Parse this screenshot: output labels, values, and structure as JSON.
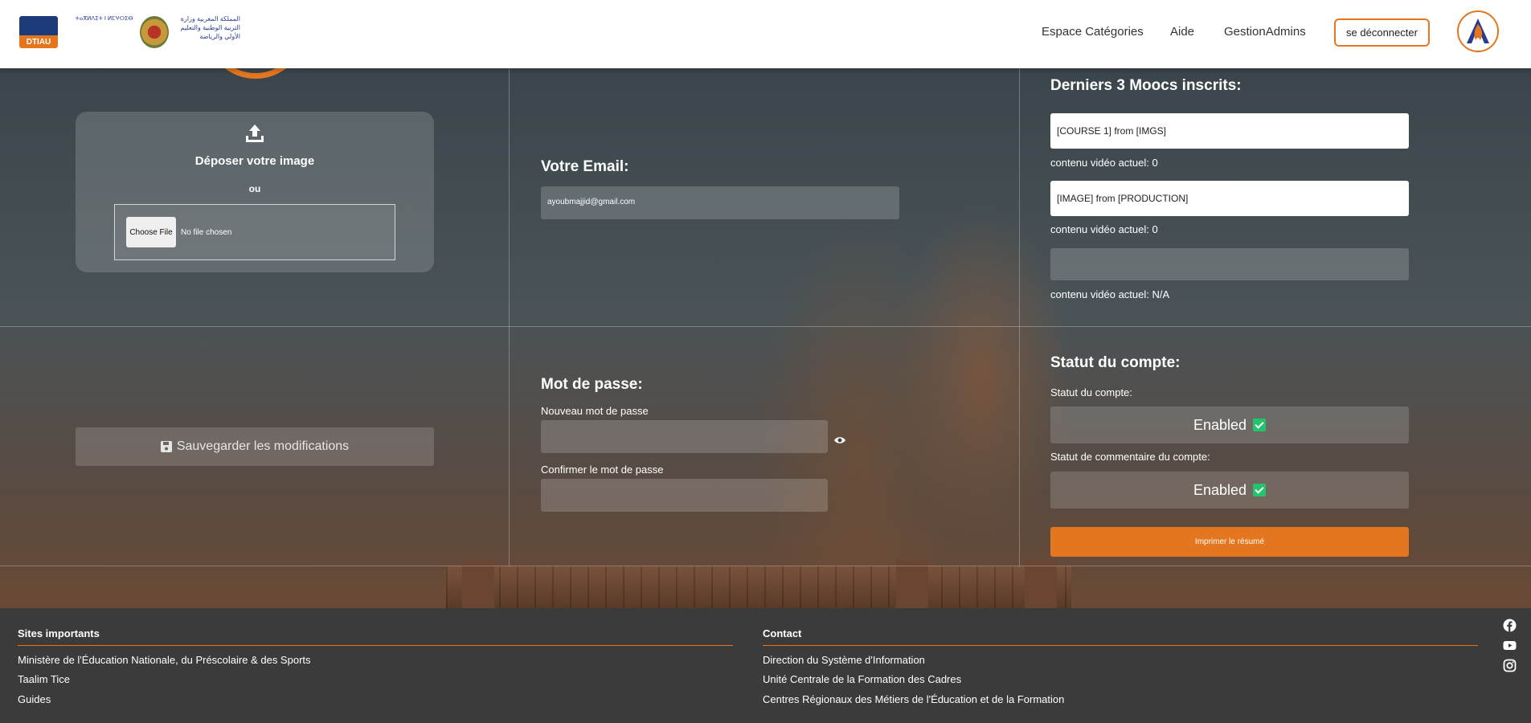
{
  "header": {
    "logo_text": "DTIAU",
    "ministry_latin": "ⵜⴰⴳⵍⴷⵉⵜ ⵏ ⵍⵎⵖⵔⵉⴱ",
    "ministry_arabic": "المملكة المغربية وزارة التربية الوطنية والتعليم الأولي والرياضة",
    "nav": [
      "Espace Catégories",
      "Aide",
      "GestionAdmins"
    ],
    "logout_label": "se déconnecter"
  },
  "upload": {
    "title": "Déposer votre image",
    "or": "ou",
    "choose_file": "Choose File",
    "no_file": "No file chosen"
  },
  "email": {
    "heading": "Votre Email:",
    "value": "ayoubmajjid@gmail.com"
  },
  "moocs": {
    "heading": "Derniers 3 Moocs inscrits:",
    "items": [
      {
        "name": "[COURSE 1] from [IMGS]",
        "count": "contenu vidéo actuel: 0"
      },
      {
        "name": "[IMAGE] from [PRODUCTION]",
        "count": "contenu vidéo actuel: 0"
      },
      {
        "name": "",
        "count": "contenu vidéo actuel: N/A"
      }
    ]
  },
  "save_label": "Sauvegarder les modifications",
  "password": {
    "heading": "Mot de passe:",
    "new_label": "Nouveau mot de passe",
    "confirm_label": "Confirmer le mot de passe"
  },
  "account": {
    "heading": "Statut du compte:",
    "status_label": "Statut du compte:",
    "status_value": "Enabled",
    "comment_label": "Statut de commentaire du compte:",
    "comment_value": "Enabled",
    "print_label": "Imprimer le résumé"
  },
  "footer": {
    "sites_heading": "Sites importants",
    "sites": [
      "Ministère de l'Éducation Nationale, du Préscolaire & des Sports",
      "Taalim Tice",
      "Guides"
    ],
    "contact_heading": "Contact",
    "contacts": [
      "Direction du Système d'Information",
      "Unité Centrale de la Formation des Cadres",
      "Centres Régionaux des Métiers de l'Éducation et de la Formation"
    ],
    "social_icons": [
      "facebook-icon",
      "youtube-icon",
      "instagram-icon"
    ]
  },
  "colors": {
    "accent": "#e4761f",
    "enabled": "#23c46b",
    "footer_bg": "#3b3b3b"
  }
}
